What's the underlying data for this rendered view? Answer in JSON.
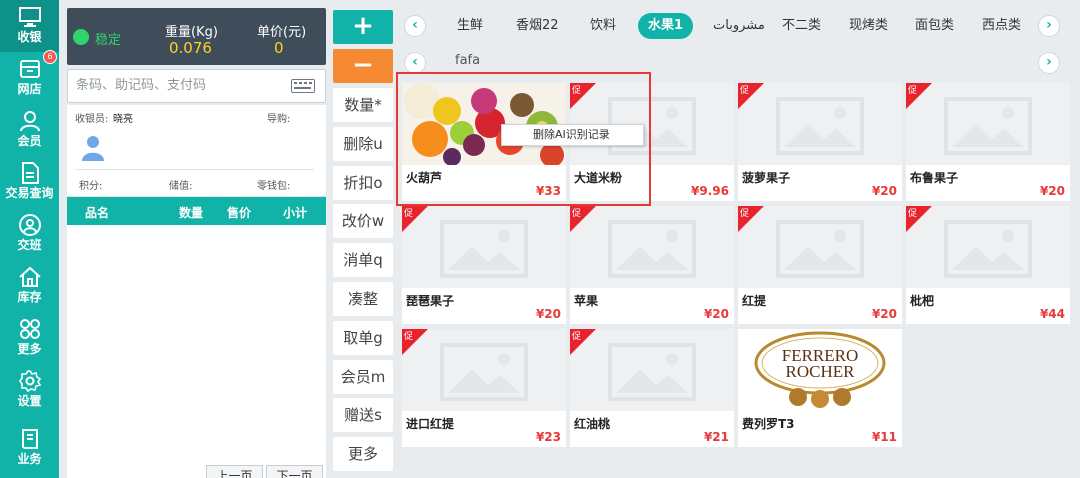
{
  "nav": [
    {
      "label": "收银",
      "icon": "monitor-icon"
    },
    {
      "label": "网店",
      "icon": "store-icon"
    },
    {
      "label": "会员",
      "icon": "user-icon"
    },
    {
      "label": "交易查询",
      "icon": "document-icon"
    },
    {
      "label": "交班",
      "icon": "handover-icon"
    },
    {
      "label": "库存",
      "icon": "home-icon"
    },
    {
      "label": "更多",
      "icon": "grid-icon"
    },
    {
      "label": "设置",
      "icon": "gear-icon"
    },
    {
      "label": "业务",
      "icon": "book-icon"
    }
  ],
  "nav_badge": "6",
  "scale": {
    "status": "稳定",
    "weight_label": "重量(Kg)",
    "weight_value": "0.076",
    "price_label": "单价(元)",
    "price_value": "0"
  },
  "search": {
    "placeholder": "条码、助记码、支付码"
  },
  "member": {
    "cashier_label": "收银员:",
    "cashier_name": "晓亮",
    "guide_label": "导购:",
    "points_label": "积分:",
    "stored_label": "储值:",
    "change_label": "零钱包:"
  },
  "order": {
    "headers": [
      "品名",
      "数量",
      "售价",
      "小计"
    ],
    "prev_page": "上一页",
    "next_page": "下一页"
  },
  "actions": [
    "+",
    "−",
    "数量*",
    "删除u",
    "折扣o",
    "改价w",
    "消单q",
    "凑整",
    "取单g",
    "会员m",
    "赠送s",
    "更多"
  ],
  "categories": [
    "生鲜",
    "香烟22",
    "饮料",
    "水果1",
    "مشروبات",
    "不二类",
    "现烤类",
    "面包类",
    "西点类"
  ],
  "active_category": "水果1",
  "subcategory": "fafa",
  "products": [
    {
      "name": "火葫芦",
      "price": "¥33",
      "promo": false,
      "image": "fruit-photo"
    },
    {
      "name": "大道米粉",
      "price": "¥9.96",
      "promo": true,
      "image": "placeholder"
    },
    {
      "name": "菠萝果子",
      "price": "¥20",
      "promo": true,
      "image": "placeholder"
    },
    {
      "name": "布鲁果子",
      "price": "¥20",
      "promo": true,
      "image": "placeholder"
    },
    {
      "name": "琵琶果子",
      "price": "¥20",
      "promo": true,
      "image": "placeholder"
    },
    {
      "name": "苹果",
      "price": "¥20",
      "promo": true,
      "image": "placeholder"
    },
    {
      "name": "红提",
      "price": "¥20",
      "promo": true,
      "image": "placeholder"
    },
    {
      "name": "枇杷",
      "price": "¥44",
      "promo": true,
      "image": "placeholder"
    },
    {
      "name": "进口红提",
      "price": "¥23",
      "promo": true,
      "image": "placeholder"
    },
    {
      "name": "红油桃",
      "price": "¥21",
      "promo": true,
      "image": "placeholder"
    },
    {
      "name": "费列罗T3",
      "price": "¥11",
      "promo": false,
      "image": "ferrero-logo"
    }
  ],
  "promo_label": "促",
  "context_menu": {
    "item": "删除AI识别记录"
  },
  "brand_logo": {
    "line1": "FERRERO",
    "line2": "ROCHER"
  },
  "colors": {
    "accent": "#11b3a8",
    "minus": "#f58a33",
    "price": "#e83838",
    "promo": "#e8232b",
    "stable": "#2fd46b",
    "scale_value": "#ffd21f"
  }
}
